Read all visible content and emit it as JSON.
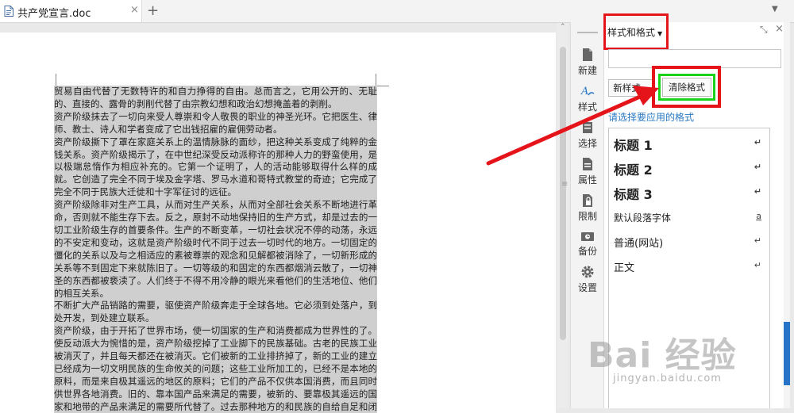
{
  "tab": {
    "title": "共产党宣言.doc",
    "close_icon": "×",
    "add_icon": "+"
  },
  "document": {
    "paragraphs": [
      "贸易自由代替了无数特许的和自力挣得的自由。总而言之，它用公开的、无耻的、直接的、露骨的剥削代替了由宗教幻想和政治幻想掩盖着的剥削。",
      "资产阶级抹去了一切向来受人尊崇和令人敬畏的职业的神圣光环。它把医生、律师、教士、诗人和学者变成了它出钱招雇的雇佣劳动者。",
      "资产阶级撕下了罩在家庭关系上的温情脉脉的面纱，把这种关系变成了纯粹的金钱关系。资产阶级揭示了，在中世纪深受反动派称许的那种人力的野蛮使用，是以极端怠惰作为相应补充的。它第一个证明了，人的活动能够取得什么样的成就。它创造了完全不同于埃及金字塔、罗马水道和哥特式教堂的奇迹；它完成了完全不同于民族大迁徙和十字军征讨的远征。",
      "资产阶级除非对生产工具，从而对生产关系，从而对全部社会关系不断地进行革命，否则就不能生存下去。反之，原封不动地保持旧的生产方式，却是过去的一切工业阶级生存的首要条件。生产的不断变革，一切社会状况不停的动荡，永远的不安定和变动，这就是资产阶级时代不同于过去一切时代的地方。一切固定的僵化的关系以及与之相适应的素被尊崇的观念和见解都被消除了，一切新形成的关系等不到固定下来就陈旧了。一切等级的和固定的东西都烟消云散了，一切神圣的东西都被亵渎了。人们终于不得不用冷静的眼光来看他们的生活地位、他们的相互关系。",
      "不断扩大产品销路的需要，驱使资产阶级奔走于全球各地。它必须到处落户，到处开发，到处建立联系。",
      "资产阶级，由于开拓了世界市场，使一切国家的生产和消费都成为世界性的了。使反动派大为惋惜的是，资产阶级挖掉了工业脚下的民族基础。古老的民族工业被消灭了，并且每天都还在被消灭。它们被新的工业排挤掉了，新的工业的建立已经成为一切文明民族的生命攸关的问题；这些工业所加工的，已经不是本地的原料，而是来自极其遥远的地区的原料；它们的产品不仅供本国消费，而且同时供世界各地消费。旧的、靠本国产品来满足的需要，被新的、要靠极其遥远的国家和地带的产品来满足的需要所代替了。过去那种地方的和民族的自给自足和闭关自守状态，被各民族的各方面的互相往来和各方面的互相依赖所代替了。物质"
    ]
  },
  "toolbar": {
    "items": [
      {
        "label": "新建",
        "icon": "new-document-icon"
      },
      {
        "label": "样式",
        "icon": "style-icon"
      },
      {
        "label": "选择",
        "icon": "select-icon"
      },
      {
        "label": "属性",
        "icon": "properties-icon"
      },
      {
        "label": "限制",
        "icon": "restrict-icon"
      },
      {
        "label": "备份",
        "icon": "backup-icon"
      },
      {
        "label": "设置",
        "icon": "gear-icon"
      }
    ]
  },
  "panel": {
    "title": "样式和格式",
    "restore_icon": "⤡",
    "close_icon": "×",
    "search_value": "",
    "new_style_label": "新样式...",
    "clear_format_label": "清除格式",
    "choose_label": "请选择要应用的格式",
    "styles": [
      {
        "name": "标题 1",
        "mark": "↵"
      },
      {
        "name": "标题 2",
        "mark": "↵"
      },
      {
        "name": "标题 3",
        "mark": "↵"
      },
      {
        "name": "默认段落字体",
        "mark": "a"
      },
      {
        "name": "普通(网站)",
        "mark": "↵"
      },
      {
        "name": "正文",
        "mark": "↵"
      }
    ]
  },
  "watermark": {
    "brand": "Bai 经验",
    "url": "jingyan.baidu.com"
  },
  "colors": {
    "accent_blue": "#2a79c4",
    "annotation_red": "#e5141a",
    "annotation_green": "#1bd21b",
    "selection_gray": "#cfcfcf"
  }
}
